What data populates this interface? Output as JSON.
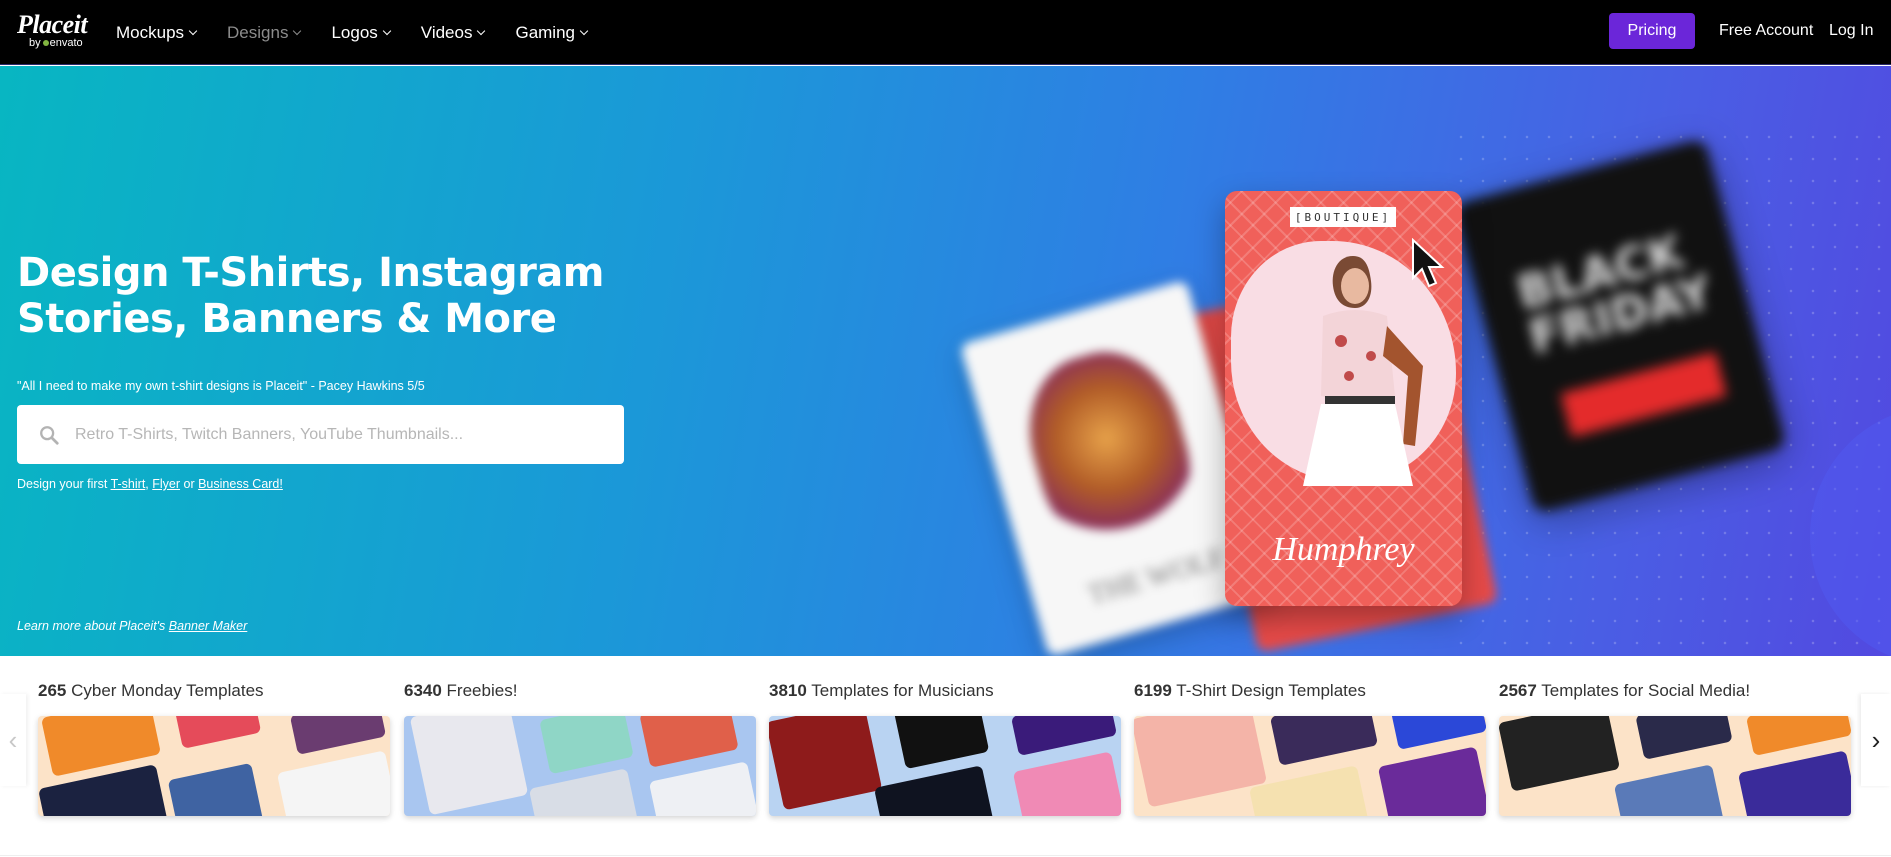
{
  "nav": {
    "logo_word": "Placeit",
    "logo_by": "by",
    "logo_envato": "envato",
    "menu": [
      {
        "label": "Mockups"
      },
      {
        "label": "Designs"
      },
      {
        "label": "Logos"
      },
      {
        "label": "Videos"
      },
      {
        "label": "Gaming"
      }
    ],
    "pricing": "Pricing",
    "free_account": "Free Account",
    "login": "Log In"
  },
  "hero": {
    "headline": "Design T-Shirts, Instagram Stories, Banners & More",
    "quote": "\"All I need to make my own t-shirt designs is Placeit\" - Pacey Hawkins 5/5",
    "search_placeholder": "Retro T-Shirts, Twitch Banners, YouTube Thumbnails...",
    "first_prefix": "Design your first ",
    "first_links": [
      "T-shirt",
      "Flyer",
      "Business Card!"
    ],
    "comma": ", ",
    "or": " or ",
    "learn_prefix": "Learn more about Placeit's ",
    "learn_link": "Banner Maker",
    "card_tag": "[BOUTIQUE]",
    "card_signature": "Humphrey",
    "blur_card_text": "BLACK FRIDAY",
    "blur_white_text": "THE WOLF"
  },
  "categories": [
    {
      "count": "265",
      "label": " Cyber Monday Templates"
    },
    {
      "count": "6340",
      "label": " Freebies!"
    },
    {
      "count": "3810",
      "label": " Templates for Musicians"
    },
    {
      "count": "6199",
      "label": " T-Shirt Design Templates"
    },
    {
      "count": "2567",
      "label": " Templates for Social Media!"
    }
  ],
  "colors": {
    "accent": "#6b26d9",
    "hero_start": "#08b6c2",
    "hero_end": "#5249e0"
  }
}
